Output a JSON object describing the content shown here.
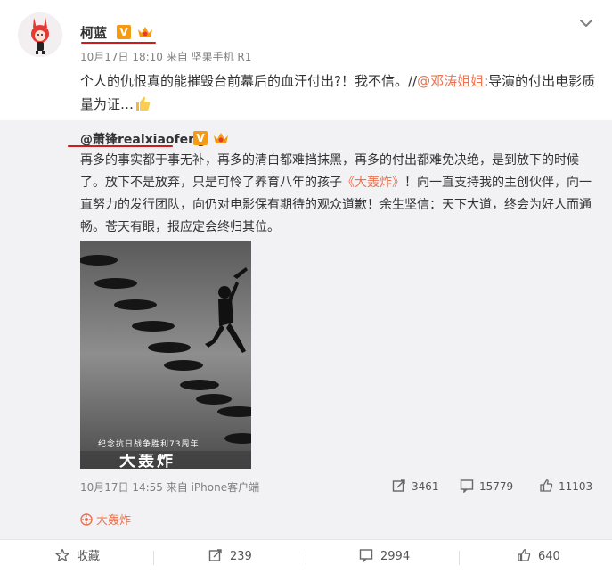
{
  "post": {
    "username": "柯蓝",
    "verified_badge": "V",
    "meta": "10月17日 18:10 来自 坚果手机 R1",
    "content_prefix": "个人的仇恨真的能摧毁台前幕后的血汗付出?！我不信。//",
    "content_mention": "@邓涛姐姐",
    "content_suffix": ":导演的付出电影质量为证…"
  },
  "repost": {
    "username": "@萧锋realxiaofeng",
    "verified_badge": "V",
    "text_1": "再多的事实都于事无补，再多的清白都难挡抹黑，再多的付出都难免决绝，是到放下的时候了。放下不是放弃，只是可怜了养育八年的孩子",
    "text_link": "《大轰炸》",
    "text_2": "！向一直支持我的主创伙伴，向一直努力的发行团队，向仍对电影保有期待的观众道歉！余生坚信：天下大道，终会为好人而通畅。苍天有眼，报应定会终归其位。",
    "poster_caption": "纪念抗日战争胜利73周年",
    "poster_title": "大轰炸",
    "meta": "10月17日 14:55 来自 iPhone客户端",
    "reposts": "3461",
    "comments": "15779",
    "likes": "11103",
    "topic": "大轰炸"
  },
  "actions": {
    "favorite": "收藏",
    "repost": "239",
    "comment": "2994",
    "like": "640"
  },
  "colors": {
    "link": "#eb7350",
    "underline": "#d01b1b",
    "badge": "#f59a14",
    "repost_bg": "#f2f2f5"
  }
}
